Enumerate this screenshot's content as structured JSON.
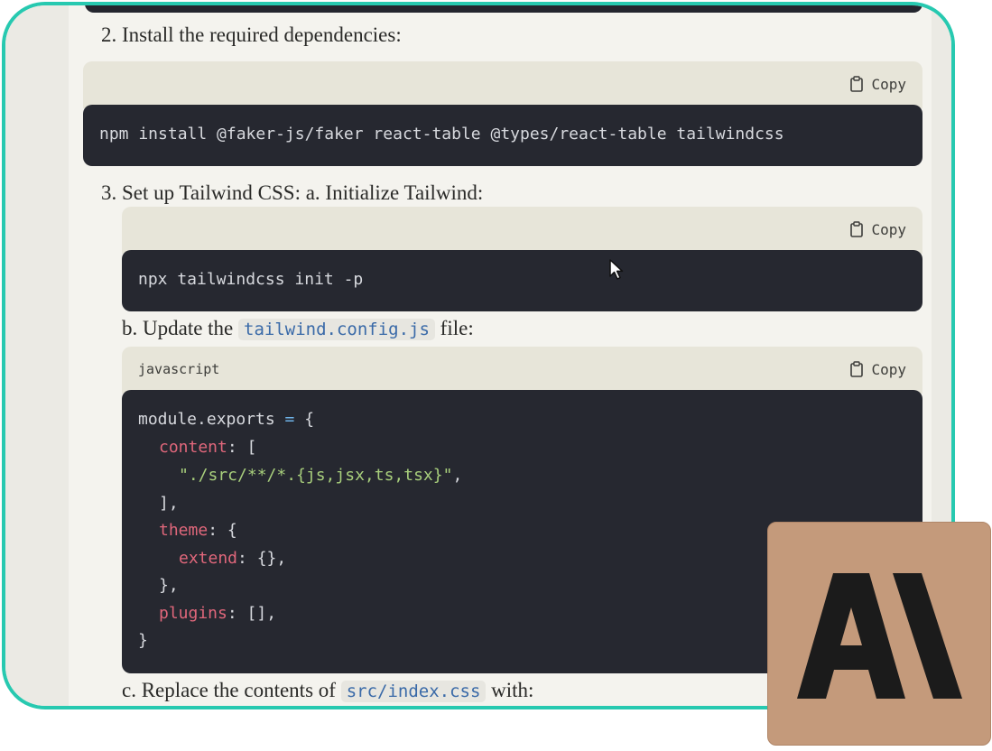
{
  "steps": {
    "step2": {
      "heading": "2. Install the required dependencies:"
    },
    "step3": {
      "heading": "3. Set up Tailwind CSS: a. Initialize Tailwind:"
    },
    "step3b": {
      "prefix": "b. Update the",
      "file": "tailwind.config.js",
      "suffix": "file:"
    },
    "step3c": {
      "prefix": "c. Replace the contents of",
      "file": "src/index.css",
      "suffix": "with:"
    }
  },
  "code_blocks": [
    {
      "lang": "",
      "copy_label": "Copy",
      "lines": [
        "npm install @faker-js/faker react-table @types/react-table tailwindcss"
      ]
    },
    {
      "lang": "",
      "copy_label": "Copy",
      "lines": [
        "npx tailwindcss init -p"
      ]
    },
    {
      "lang": "javascript",
      "copy_label": "Copy",
      "tokens": {
        "l1_a": "module.exports",
        "l1_b": " = ",
        "l1_c": "{",
        "l2_key": "content",
        "l2_rest": ": [",
        "l3_str": "\"./src/**/*.{js,jsx,ts,tsx}\"",
        "l3_rest": ",",
        "l4": "],",
        "l5_key": "theme",
        "l5_rest": ": {",
        "l6_key": "extend",
        "l6_rest": ": {},",
        "l7": "},",
        "l8_key": "plugins",
        "l8_rest": ": [],",
        "l9": "}"
      }
    }
  ],
  "colors": {
    "accent_border": "#27c9b0",
    "logo_bg": "#c49a7b"
  },
  "logo": {
    "name": "anthropic-logo",
    "text": "AI"
  }
}
